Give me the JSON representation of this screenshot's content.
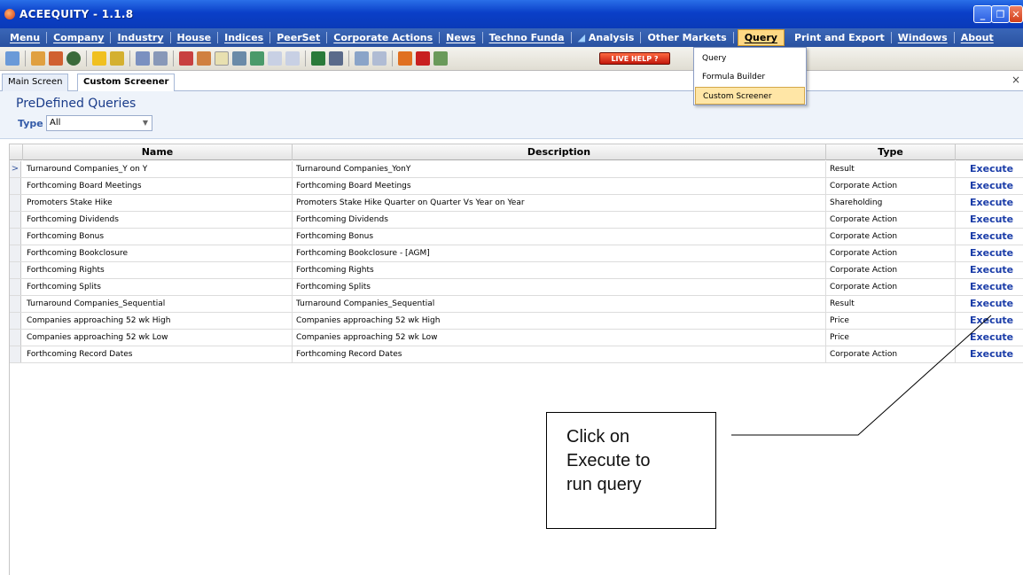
{
  "window": {
    "title": "ACEEQUITY  - 1.1.8"
  },
  "menubar": {
    "items": [
      "Menu",
      "Company",
      "Industry",
      "House",
      "Indices",
      "PeerSet",
      "Corporate Actions",
      "News",
      "Techno Funda",
      "Analysis",
      "Other Markets",
      "Query",
      "Print and Export",
      "Windows",
      "About"
    ]
  },
  "toolbar": {
    "live_help": "LIVE HELP"
  },
  "query_menu": {
    "items": [
      "Query",
      "Formula Builder",
      "Custom Screener"
    ]
  },
  "tabs": {
    "main": "Main Screen",
    "custom": "Custom Screener"
  },
  "screener": {
    "title": "PreDefined Queries",
    "type_label": "Type :",
    "type_value": "All"
  },
  "grid": {
    "columns": [
      "Name",
      "Description",
      "Type",
      ""
    ],
    "rows": [
      {
        "name": "Turnaround Companies_Y on Y",
        "description": "Turnaround Companies_YonY",
        "type": "Result",
        "action": "Execute"
      },
      {
        "name": "Forthcoming Board Meetings",
        "description": "Forthcoming Board Meetings",
        "type": "Corporate Action",
        "action": "Execute"
      },
      {
        "name": "Promoters Stake Hike",
        "description": "Promoters Stake Hike Quarter on Quarter Vs Year on Year",
        "type": "Shareholding",
        "action": "Execute"
      },
      {
        "name": "Forthcoming Dividends",
        "description": "Forthcoming Dividends",
        "type": "Corporate Action",
        "action": "Execute"
      },
      {
        "name": "Forthcoming Bonus",
        "description": "Forthcoming Bonus",
        "type": "Corporate Action",
        "action": "Execute"
      },
      {
        "name": "Forthcoming Bookclosure",
        "description": "Forthcoming Bookclosure - [AGM]",
        "type": "Corporate Action",
        "action": "Execute"
      },
      {
        "name": "Forthcoming Rights",
        "description": "Forthcoming Rights",
        "type": "Corporate Action",
        "action": "Execute"
      },
      {
        "name": "Forthcoming Splits",
        "description": "Forthcoming Splits",
        "type": "Corporate Action",
        "action": "Execute"
      },
      {
        "name": "Turnaround Companies_Sequential",
        "description": "Turnaround Companies_Sequential",
        "type": "Result",
        "action": "Execute"
      },
      {
        "name": "Companies approaching 52 wk High",
        "description": "Companies approaching 52 wk High",
        "type": "Price",
        "action": "Execute"
      },
      {
        "name": "Companies approaching 52 wk Low",
        "description": "Companies approaching 52 wk Low",
        "type": "Price",
        "action": "Execute"
      },
      {
        "name": "Forthcoming Record Dates",
        "description": "Forthcoming Record Dates",
        "type": "Corporate Action",
        "action": "Execute"
      }
    ]
  },
  "callout": {
    "line1": "Click on",
    "line2": "Execute to",
    "line3": "run query"
  },
  "colors": {
    "accent": "#1a3ca8",
    "menubar": "#2a52a0",
    "titlebar": "#0a3fc8"
  }
}
